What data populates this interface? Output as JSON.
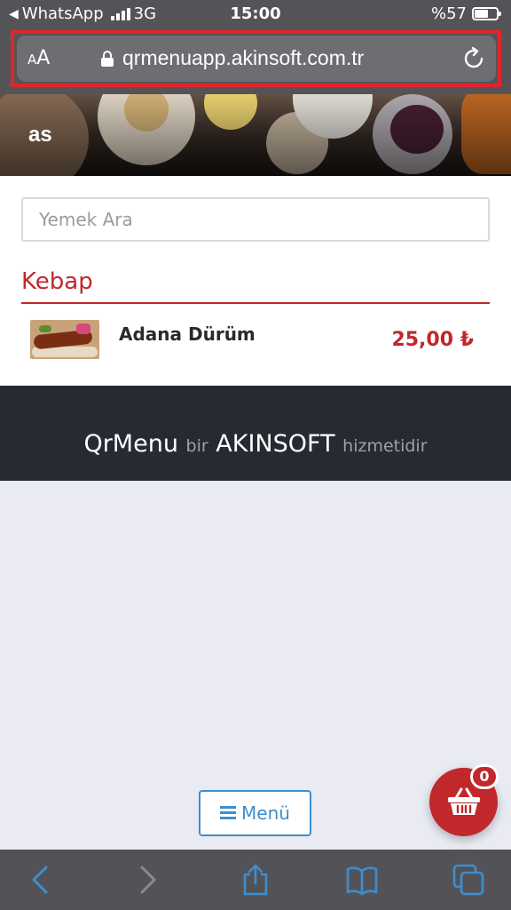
{
  "statusbar": {
    "back_app": "WhatsApp",
    "network": "3G",
    "time": "15:00",
    "battery": "%57",
    "battery_level": 0.57
  },
  "browser": {
    "text_size_label_small": "A",
    "text_size_label_large": "A",
    "url": "qrmenuapp.akinsoft.com.tr"
  },
  "hero": {
    "title": "as"
  },
  "search": {
    "placeholder": "Yemek Ara"
  },
  "category": {
    "title": "Kebap",
    "items": [
      {
        "name": "Adana Dürüm",
        "price": "25,00 ₺"
      }
    ]
  },
  "footer": {
    "brand_app": "QrMenu",
    "connector": "bir",
    "brand_company": "AKINSOFT",
    "suffix": "hizmetidir"
  },
  "menu_button": {
    "label": "Menü"
  },
  "basket": {
    "count": "0"
  },
  "colors": {
    "accent_red": "#c0282c",
    "accent_blue": "#3a8fd0",
    "footer_bg": "#272a33",
    "highlight_outline": "#e4242b"
  }
}
